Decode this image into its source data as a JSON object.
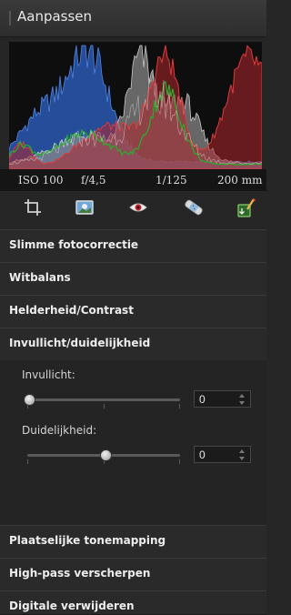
{
  "panel": {
    "title": "Aanpassen"
  },
  "histogram": {
    "colors": {
      "blue": "#2f63c8",
      "gray": "#8a8a8a",
      "red": "#b0262b",
      "green": "#22b22a",
      "white": "#e6e6e6"
    }
  },
  "exif": {
    "iso": "ISO 100",
    "aperture": "f/4,5",
    "shutter": "1/125",
    "focal": "200 mm"
  },
  "toolbar": {
    "tools": [
      {
        "icon": "crop-icon"
      },
      {
        "icon": "photo-icon"
      },
      {
        "icon": "red-eye-icon"
      },
      {
        "icon": "bandage-icon"
      },
      {
        "icon": "tools-icon"
      }
    ]
  },
  "sections": {
    "slimme": "Slimme fotocorrectie",
    "witbalans": "Witbalans",
    "helderheid": "Helderheid/Contrast",
    "invullicht": "Invullicht/duidelijkheid",
    "plaatselijke": "Plaatselijke tonemapping",
    "highpass": "High-pass verscherpen",
    "digitale": "Digitale verwijderen"
  },
  "invullicht_panel": {
    "fill_label": "Invullicht:",
    "fill_value": "0",
    "fill_level": 0.0,
    "clarity_label": "Duidelijkheid:",
    "clarity_value": "0",
    "clarity_level": 0.5
  }
}
